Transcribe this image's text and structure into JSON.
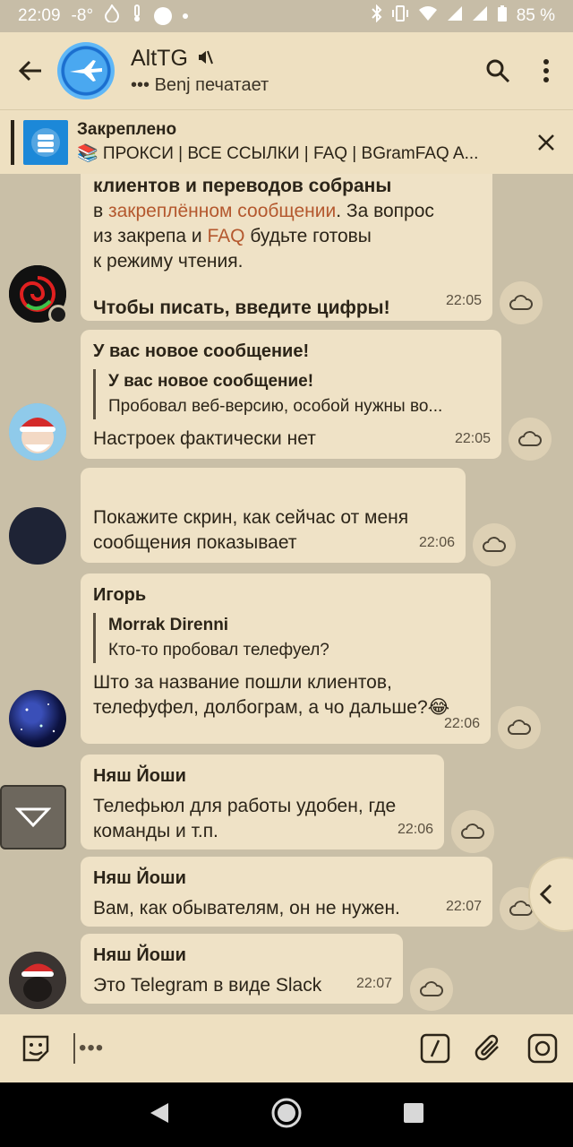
{
  "status": {
    "time": "22:09",
    "temp": "-8°",
    "battery": "85 %"
  },
  "header": {
    "title": "AltTG",
    "subtitle": "••• Benj печатает"
  },
  "pinned": {
    "title": "Закреплено",
    "text": "📚 ПРОКСИ | ВСЕ ССЫЛКИ | FAQ | BGramFAQ   A..."
  },
  "messages": [
    {
      "line1": "клиентов и переводов собраны",
      "line2a": "в ",
      "link1": "закреплённом сообщении",
      "line2b": ". За вопрос",
      "line3a": "из закрепа и ",
      "link2": "FAQ",
      "line3b": " будьте готовы",
      "line4": "к режиму чтения.",
      "line5": "Чтобы писать, введите цифры!",
      "time": "22:05"
    },
    {
      "sender": "У вас новое сообщение!",
      "reply_name": "У вас новое сообщение!",
      "reply_text": "Пробовал веб-версию, особой нужны во...",
      "text": "Настроек фактически нет",
      "time": "22:05"
    },
    {
      "text1": "Покажите скрин, как сейчас от меня",
      "text2": "сообщения показывает",
      "time": "22:06"
    },
    {
      "sender": "Игорь",
      "reply_name": "Morrak Direnni",
      "reply_text": "Кто-то пробовал телефуел?",
      "text1": "Што за название пошли клиентов,",
      "text2": "телефуфел, долбограм, а чо дальше?😂",
      "time": "22:06"
    },
    {
      "sender": "Няш Йоши",
      "text1": "Телефьюл для работы удобен, где",
      "text2": "команды и т.п.",
      "time": "22:06"
    },
    {
      "sender": "Няш Йоши",
      "text": "Вам, как обывателям, он не нужен.",
      "time": "22:07"
    },
    {
      "sender": "Няш Йоши",
      "text": "Это Telegram в виде Slack",
      "time": "22:07"
    }
  ],
  "input": {
    "placeholder": "•••"
  },
  "colors": {
    "bubble": "#efe2c6",
    "bar": "#eee0c1",
    "link": "#b4582e",
    "background": "#c9bfa7"
  }
}
